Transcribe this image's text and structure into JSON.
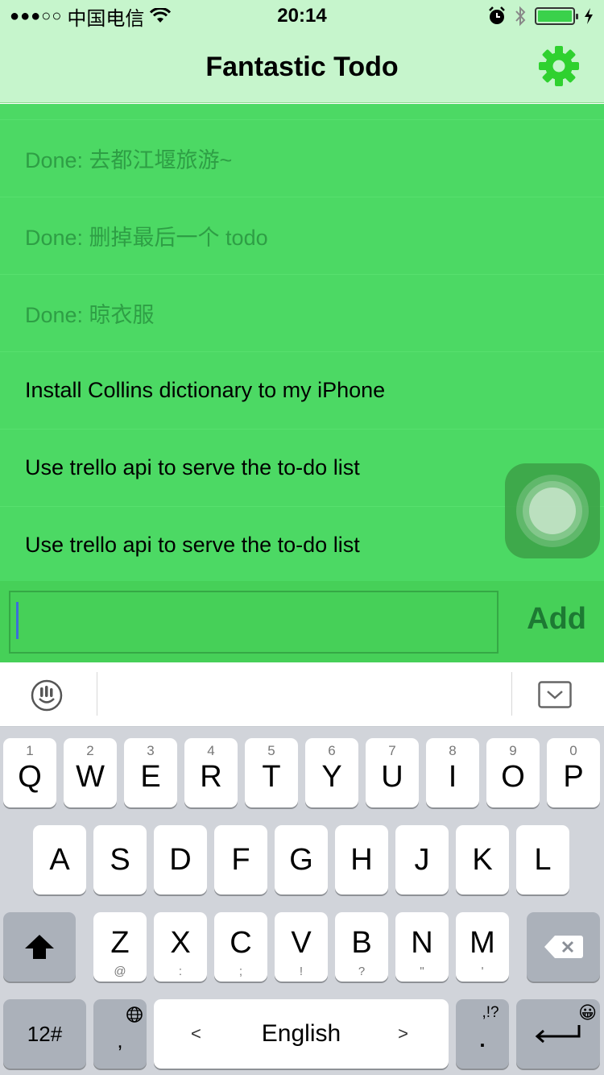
{
  "status_bar": {
    "signal": "●●●○○",
    "carrier": "中国电信",
    "time": "20:14"
  },
  "nav": {
    "title": "Fantastic Todo",
    "settings_icon": "gear-icon"
  },
  "todos": [
    {
      "text": "Done: 去都江堰旅游~",
      "done": true
    },
    {
      "text": "Done: 删掉最后一个 todo",
      "done": true
    },
    {
      "text": "Done: 晾衣服",
      "done": true
    },
    {
      "text": "Install Collins dictionary to my iPhone",
      "done": false
    },
    {
      "text": "Use trello api to serve the to-do list",
      "done": false
    },
    {
      "text": "Use trello api to serve the to-do list",
      "done": false
    }
  ],
  "input": {
    "value": "",
    "add_label": "Add"
  },
  "keyboard": {
    "row1": [
      {
        "letter": "Q",
        "hint": "1"
      },
      {
        "letter": "W",
        "hint": "2"
      },
      {
        "letter": "E",
        "hint": "3"
      },
      {
        "letter": "R",
        "hint": "4"
      },
      {
        "letter": "T",
        "hint": "5"
      },
      {
        "letter": "Y",
        "hint": "6"
      },
      {
        "letter": "U",
        "hint": "7"
      },
      {
        "letter": "I",
        "hint": "8"
      },
      {
        "letter": "O",
        "hint": "9"
      },
      {
        "letter": "P",
        "hint": "0"
      }
    ],
    "row2": [
      "A",
      "S",
      "D",
      "F",
      "G",
      "H",
      "J",
      "K",
      "L"
    ],
    "row3": [
      {
        "letter": "Z",
        "hint": "@"
      },
      {
        "letter": "X",
        "hint": ":"
      },
      {
        "letter": "C",
        "hint": ";"
      },
      {
        "letter": "V",
        "hint": "!"
      },
      {
        "letter": "B",
        "hint": "?"
      },
      {
        "letter": "N",
        "hint": "\""
      },
      {
        "letter": "M",
        "hint": "'"
      }
    ],
    "numbers_label": "12#",
    "comma_label": ",",
    "space_label": "English",
    "space_left_arrow": "<",
    "space_right_arrow": ">",
    "punct_label": ".",
    "punct_hint": ",!?",
    "emoji": "😀"
  },
  "colors": {
    "list_bg": "#4cd964",
    "nav_bg": "#c6f5cc",
    "gear": "#2fd12f",
    "done_text": "#2e9e45",
    "add_text": "#1d7a33"
  }
}
